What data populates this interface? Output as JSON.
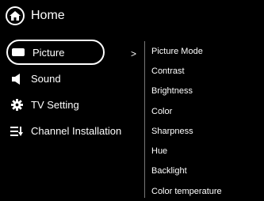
{
  "header": {
    "title": "Home",
    "icon": "home-icon"
  },
  "menu": {
    "items": [
      {
        "label": "Picture",
        "icon": "picture-icon",
        "selected": true
      },
      {
        "label": "Sound",
        "icon": "speaker-icon",
        "selected": false
      },
      {
        "label": "TV Setting",
        "icon": "gear-icon",
        "selected": false
      },
      {
        "label": "Channel Installation",
        "icon": "channel-list-icon",
        "selected": false
      }
    ],
    "submenu_indicator": ">"
  },
  "submenu": {
    "items": [
      {
        "label": "Picture Mode"
      },
      {
        "label": "Contrast"
      },
      {
        "label": "Brightness"
      },
      {
        "label": "Color"
      },
      {
        "label": "Sharpness"
      },
      {
        "label": "Hue"
      },
      {
        "label": "Backlight"
      },
      {
        "label": "Color temperature"
      }
    ]
  }
}
